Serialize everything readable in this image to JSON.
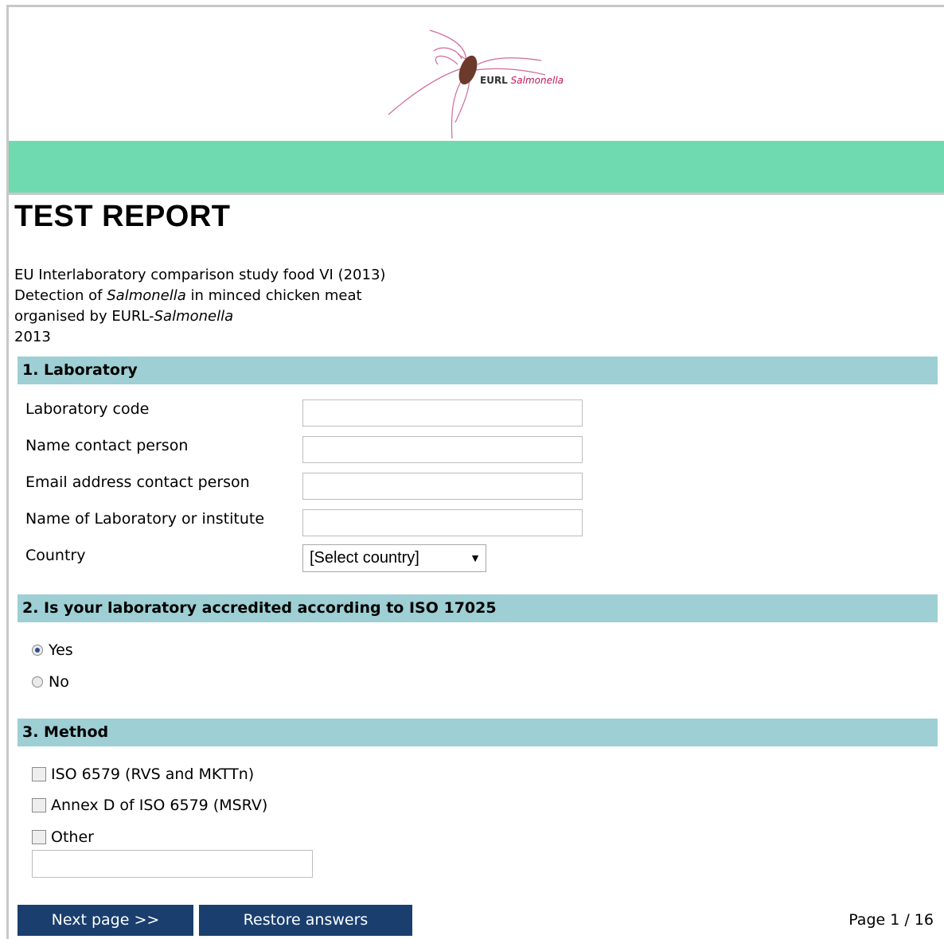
{
  "logo": {
    "brand_bold": "EURL",
    "brand_italic": "Salmonella",
    "accent_color": "#c2185b"
  },
  "header": {
    "band_color": "#6fd9b0"
  },
  "title": "TEST REPORT",
  "intro": {
    "line1": "EU Interlaboratory comparison study food VI (2013)",
    "line2_pre": "Detection of ",
    "line2_italic": "Salmonella",
    "line2_post": " in minced chicken meat",
    "line3_pre": "organised by EURL-",
    "line3_italic": "Salmonella",
    "line4": "2013"
  },
  "section1": {
    "heading": "1. Laboratory",
    "fields": [
      {
        "label": "Laboratory code",
        "value": ""
      },
      {
        "label": "Name contact person",
        "value": ""
      },
      {
        "label": "Email address contact person",
        "value": ""
      },
      {
        "label": "Name of Laboratory or institute",
        "value": ""
      }
    ],
    "country_label": "Country",
    "country_selected": "[Select country]"
  },
  "section2": {
    "heading": "2. Is your laboratory accredited according to ISO 17025",
    "options": [
      {
        "label": "Yes",
        "checked": true
      },
      {
        "label": "No",
        "checked": false
      }
    ]
  },
  "section3": {
    "heading": "3. Method",
    "options": [
      {
        "label": "ISO 6579 (RVS and MKTTn)",
        "checked": false
      },
      {
        "label": "Annex D of ISO 6579 (MSRV)",
        "checked": false
      },
      {
        "label": "Other",
        "checked": false
      }
    ],
    "other_value": ""
  },
  "footer": {
    "next_label": "Next page >>",
    "restore_label": "Restore answers",
    "page_indicator": "Page 1 / 16",
    "button_color": "#1a3f6e"
  }
}
